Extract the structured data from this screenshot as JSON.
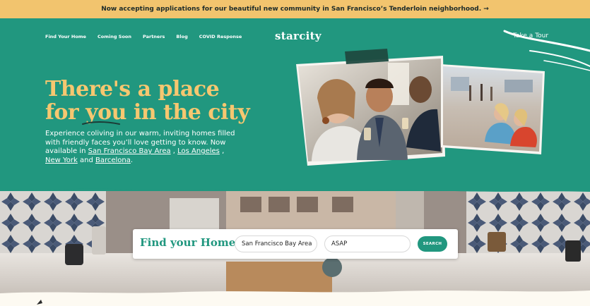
{
  "banner": {
    "text": "Now accepting applications for our beautiful new community in San Francisco’s Tenderloin neighborhood. →"
  },
  "nav": {
    "items": [
      {
        "label": "Find Your Home"
      },
      {
        "label": "Coming Soon"
      },
      {
        "label": "Partners"
      },
      {
        "label": "Blog"
      },
      {
        "label": "COVID Response"
      }
    ],
    "logo": "starcity",
    "tour": "Take a Tour"
  },
  "hero": {
    "headline_line1": "There's a place",
    "headline_for": "for ",
    "headline_you": "you",
    "headline_rest": " in the city",
    "subtext": "Experience coliving in our warm, inviting homes filled with friendly faces you’ll love getting to know. Now available in ",
    "cities": [
      "San Francisco Bay Area",
      "Los Angeles",
      "New York",
      "Barcelona"
    ],
    "sep1": " , ",
    "sep2": " , ",
    "sep3": " and ",
    "end": "."
  },
  "search": {
    "title": "Find your Home",
    "city_value": "San Francisco Bay Area",
    "date_value": "ASAP",
    "button": "SEARCH"
  },
  "colors": {
    "banner": "#f2c46e",
    "hero": "#21977f",
    "headline": "#f6c770",
    "background": "#fdfaf2"
  }
}
